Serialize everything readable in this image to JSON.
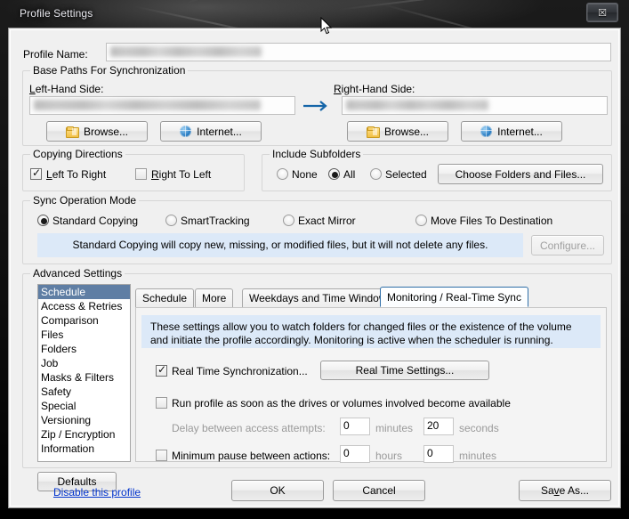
{
  "window": {
    "title": "Profile Settings",
    "close_label": "☒"
  },
  "profile": {
    "name_label": "Profile Name:",
    "name_value": ""
  },
  "base_paths": {
    "group_title": "Base Paths For Synchronization",
    "left_label": "Left-Hand Side:",
    "right_label": "Right-Hand Side:",
    "left_value": "",
    "right_value": "",
    "direction_arrow": "→",
    "left_browse": "Browse...",
    "left_internet": "Internet...",
    "right_browse": "Browse...",
    "right_internet": "Internet..."
  },
  "copying_directions": {
    "group_title": "Copying Directions",
    "left_to_right": {
      "label": "Left To Right",
      "checked": true
    },
    "right_to_left": {
      "label": "Right To Left",
      "checked": false
    }
  },
  "include_subfolders": {
    "group_title": "Include Subfolders",
    "options": [
      {
        "label": "None",
        "selected": false
      },
      {
        "label": "All",
        "selected": true
      },
      {
        "label": "Selected",
        "selected": false
      }
    ],
    "choose_button": "Choose Folders and Files..."
  },
  "sync_mode": {
    "group_title": "Sync Operation Mode",
    "options": [
      {
        "label": "Standard Copying",
        "selected": true
      },
      {
        "label": "SmartTracking",
        "selected": false
      },
      {
        "label": "Exact Mirror",
        "selected": false
      },
      {
        "label": "Move Files To Destination",
        "selected": false
      }
    ],
    "info": "Standard Copying will copy new, missing, or modified files, but it will not delete any files.",
    "configure_button": "Configure...",
    "configure_enabled": false
  },
  "advanced": {
    "group_title": "Advanced Settings",
    "items": [
      {
        "label": "Schedule",
        "selected": true
      },
      {
        "label": "Access & Retries",
        "selected": false
      },
      {
        "label": "Comparison",
        "selected": false
      },
      {
        "label": "Files",
        "selected": false
      },
      {
        "label": "Folders",
        "selected": false
      },
      {
        "label": "Job",
        "selected": false
      },
      {
        "label": "Masks & Filters",
        "selected": false
      },
      {
        "label": "Safety",
        "selected": false
      },
      {
        "label": "Special",
        "selected": false
      },
      {
        "label": "Versioning",
        "selected": false
      },
      {
        "label": "Zip / Encryption",
        "selected": false
      },
      {
        "label": "Information",
        "selected": false
      }
    ],
    "defaults_button": "Defaults"
  },
  "tabs": [
    {
      "label": "Schedule",
      "active": false
    },
    {
      "label": "More",
      "active": false
    },
    {
      "label": "Weekdays and Time Window",
      "active": false
    },
    {
      "label": "Monitoring / Real-Time Sync",
      "active": true
    }
  ],
  "monitoring": {
    "info": "These settings allow you to watch folders for changed files or the existence of the volume and initiate the profile accordingly. Monitoring is active when the scheduler is running.",
    "real_time_sync": {
      "label": "Real Time Synchronization...",
      "checked": true
    },
    "real_time_settings_button": "Real Time Settings...",
    "run_on_available": {
      "label": "Run profile as soon as the drives or volumes involved become available",
      "checked": false
    },
    "delay_label": "Delay between access attempts:",
    "delay_minutes_value": "0",
    "delay_minutes_unit": "minutes",
    "delay_seconds_value": "20",
    "delay_seconds_unit": "seconds",
    "min_pause": {
      "label": "Minimum pause between actions:",
      "checked": false
    },
    "pause_hours_value": "0",
    "pause_hours_unit": "hours",
    "pause_minutes_value": "0",
    "pause_minutes_unit": "minutes"
  },
  "footer": {
    "disable_link": "Disable this profile",
    "ok": "OK",
    "cancel": "Cancel",
    "save_as": "Save As..."
  },
  "colors": {
    "selection_blue": "#5f7ea4",
    "info_banner": "#dce9f8",
    "link_blue": "#0033cc",
    "arrow_blue": "#1565a8",
    "active_tab_border": "#2f6fa8"
  }
}
